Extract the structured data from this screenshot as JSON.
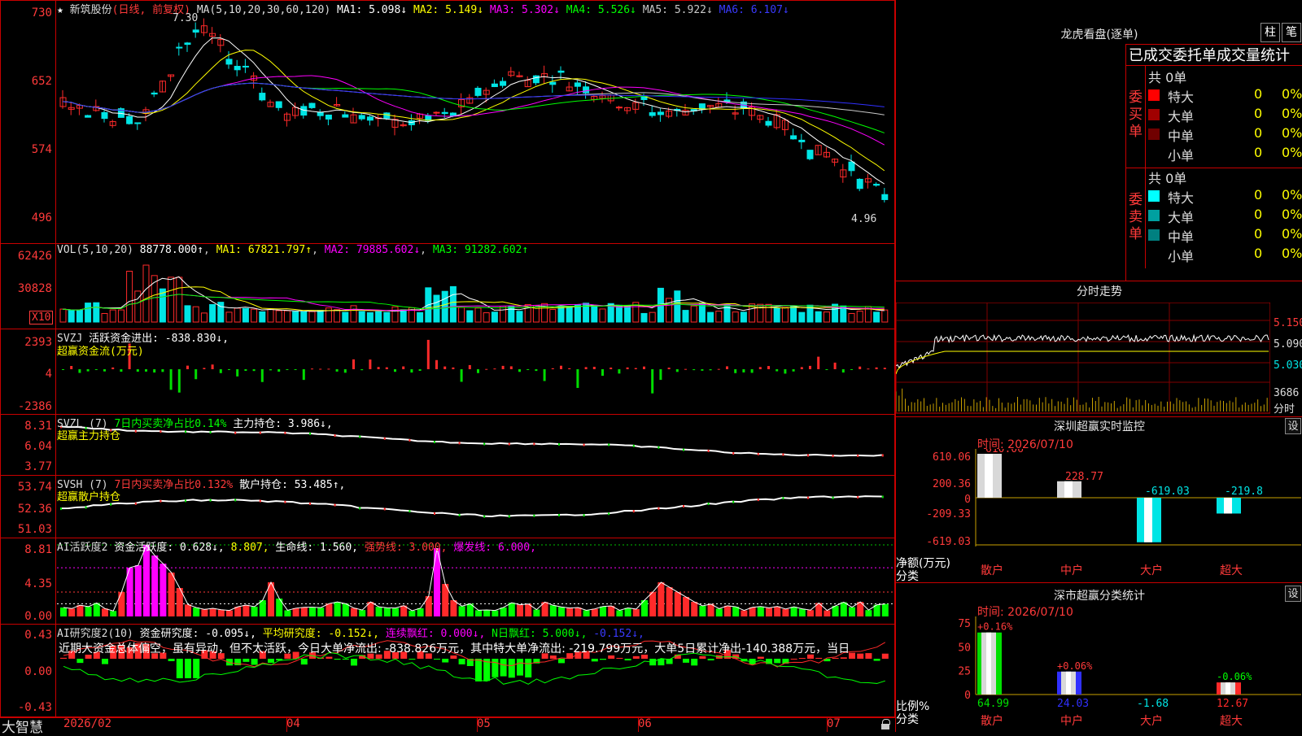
{
  "app": {
    "name": "大智慧",
    "stock_name": "新筑股份"
  },
  "colors": {
    "up": "#ff2a2a",
    "down": "#00e5e5",
    "bg": "#000000",
    "grid": "#c80000",
    "ma1": "#ffffff",
    "ma2": "#ffff00",
    "ma3": "#ff00ff",
    "ma4": "#00ff00",
    "ma5": "#c8c8c8",
    "ma6": "#3030ff"
  },
  "kline": {
    "header": {
      "mode": "(日线, 前复权)",
      "ma_params": "MA(5,10,20,30,60,120)",
      "ma1": "MA1: 5.098↓",
      "ma2": "MA2: 5.149↓",
      "ma3": "MA3: 5.302↓",
      "ma4": "MA4: 5.526↓",
      "ma5": "MA5: 5.922↓",
      "ma6": "MA6: 6.107↓"
    },
    "y_ticks": [
      "730",
      "652",
      "574",
      "496"
    ],
    "high_label": "7.30",
    "low_label": "4.96"
  },
  "volume": {
    "header": {
      "params": "VOL(5,10,20)",
      "vol": "88778.000↑",
      "ma1": "MA1: 67821.797↑",
      "ma2": "MA2: 79885.602↓",
      "ma3": "MA3: 91282.602↑"
    },
    "y_ticks": [
      "62426",
      "30828"
    ],
    "unit": "X10"
  },
  "svzj": {
    "header": {
      "name": "SVZJ",
      "text": "活跃资金进出: -838.830↓,"
    },
    "subtitle": "超赢资金流(万元)",
    "y_ticks": [
      "2393",
      "4",
      "-2386"
    ]
  },
  "svzl": {
    "header": {
      "name": "SVZL (7)",
      "text1": "7日内买卖净占比0.14%",
      "text2": "主力持仓: 3.986↓,"
    },
    "subtitle": "超赢主力持仓",
    "y_ticks": [
      "8.31",
      "6.04",
      "3.77"
    ]
  },
  "svsh": {
    "header": {
      "name": "SVSH (7)",
      "text1": "7日内买卖净占比0.132%",
      "text2": "散户持仓: 53.485↑,"
    },
    "subtitle": "超赢散户持仓",
    "y_ticks": [
      "53.74",
      "52.36",
      "51.03"
    ]
  },
  "ai_active": {
    "header": {
      "name": "AI活跃度2",
      "t1": "资金活跃度: 0.628↓,",
      "t2": "8.807,",
      "t3": "生命线: 1.560,",
      "t4": "强势线: 3.000,",
      "t5": "爆发线: 6.000,"
    },
    "y_ticks": [
      "8.81",
      "4.35",
      "0.00"
    ]
  },
  "ai_research": {
    "header": {
      "name": "AI研究度2(10)",
      "t1": "资金研究度: -0.095↓,",
      "t2": "平均研究度: -0.152↓,",
      "t3": "连续飘红: 0.000↓,",
      "t4": "N日飘红: 5.000↓,",
      "t5": "-0.152↓,"
    },
    "comment": "近期大资金总体偏空，虽有异动，但不太活跃，今日大单净流出: -838.826万元，其中特大单净流出: -219.799万元，大单5日累计净出-140.388万元，当日",
    "y_ticks": [
      "0.43",
      "0.00",
      "-0.43"
    ]
  },
  "x_axis": {
    "labels": [
      "2026/02",
      "04",
      "05",
      "06",
      "07"
    ]
  },
  "dragon": {
    "title": "龙虎看盘(逐单)",
    "btn1": "柱",
    "btn2": "笔",
    "table_title": "已成交委托单成交量统计",
    "buy_side": "委买单",
    "sell_side": "委卖单",
    "buy_total": "共 0单",
    "sell_total": "共 0单",
    "rows_buy": [
      {
        "label": "特大",
        "count": "0",
        "pct": "0%",
        "color": "#ff0000"
      },
      {
        "label": "大单",
        "count": "0",
        "pct": "0%",
        "color": "#a00000"
      },
      {
        "label": "中单",
        "count": "0",
        "pct": "0%",
        "color": "#700000"
      },
      {
        "label": "小单",
        "count": "0",
        "pct": "0%",
        "color": ""
      }
    ],
    "rows_sell": [
      {
        "label": "特大",
        "count": "0",
        "pct": "0%",
        "color": "#00ffff"
      },
      {
        "label": "大单",
        "count": "0",
        "pct": "0%",
        "color": "#00a0a0"
      },
      {
        "label": "中单",
        "count": "0",
        "pct": "0%",
        "color": "#008080"
      },
      {
        "label": "小单",
        "count": "0",
        "pct": "0%",
        "color": ""
      }
    ]
  },
  "intraday": {
    "title": "分时走势",
    "prices": [
      "5.150",
      "5.090",
      "5.030"
    ],
    "volume_label": "3686",
    "unit_label": "分时"
  },
  "sz_monitor": {
    "title": "深圳超赢实时监控",
    "settings_icon": "设",
    "time": "时间: 2026/07/10",
    "y_ticks": [
      "610.06",
      "200.36",
      "0",
      "-209.33",
      "-619.03"
    ],
    "y_title": "净额(万元)",
    "x_title": "分类",
    "chart_data": {
      "type": "bar",
      "categories": [
        "散户",
        "中户",
        "大户",
        "超大"
      ],
      "values": [
        610.06,
        228.77,
        -619.03,
        -219.8
      ],
      "value_labels": [
        "610.06",
        "228.77",
        "-619.03",
        "-219.8"
      ],
      "ylim": [
        -619.03,
        610.06
      ]
    }
  },
  "sz_class": {
    "title": "深市超赢分类统计",
    "settings_icon": "设",
    "time": "时间: 2026/07/10",
    "y_ticks": [
      "75",
      "50",
      "25",
      "0"
    ],
    "y_title": "比例%",
    "x_title": "分类",
    "chart_data": {
      "type": "bar",
      "categories": [
        "散户",
        "中户",
        "大户",
        "超大"
      ],
      "values": [
        64.99,
        24.03,
        -1.68,
        12.67
      ],
      "value_labels": [
        "64.99",
        "24.03",
        "-1.68",
        "12.67"
      ],
      "change_labels": [
        "+0.16%",
        "+0.06%",
        "",
        "-0.06%"
      ],
      "ylim": [
        0,
        75
      ]
    }
  }
}
